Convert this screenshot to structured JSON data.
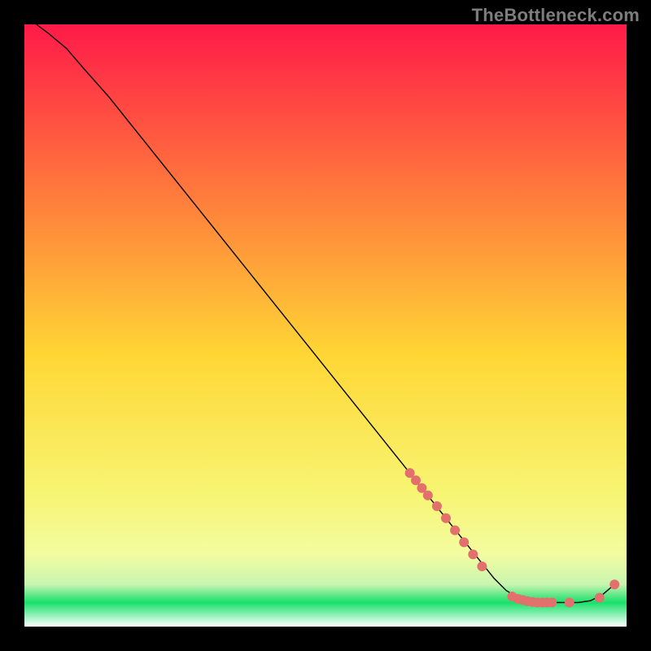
{
  "watermark": "TheBottleneck.com",
  "chart_data": {
    "type": "line",
    "title": "",
    "xlabel": "",
    "ylabel": "",
    "xlim": [
      0,
      100
    ],
    "ylim": [
      0,
      100
    ],
    "grid": false,
    "background_gradient": {
      "top_color": "#ff1a49",
      "mid_top_color": "#ff7a3c",
      "mid_color": "#ffd735",
      "mid_bot_color": "#f7f573",
      "green_band_color": "#18e06a",
      "bottom_color": "#ffffff",
      "green_band_start_y": 93,
      "green_band_end_y": 98
    },
    "series": [
      {
        "name": "curve",
        "color": "#000000",
        "stroke_width": 1.4,
        "x": [
          2,
          4,
          7,
          10,
          14,
          18,
          22,
          26,
          30,
          34,
          38,
          42,
          46,
          50,
          54,
          58,
          62,
          64,
          66,
          68,
          70,
          72,
          74,
          76,
          78,
          80,
          82,
          84,
          86,
          88,
          90,
          92,
          94,
          96,
          98
        ],
        "y": [
          100,
          98.5,
          96,
          92.5,
          88,
          83,
          78,
          73,
          68,
          63,
          58,
          53,
          48,
          43,
          38,
          33,
          28,
          25.5,
          23,
          20.5,
          18,
          15.5,
          13,
          10.5,
          8,
          6,
          4.8,
          4.2,
          4,
          4,
          4,
          4,
          4.3,
          5.3,
          7
        ]
      }
    ],
    "scatter": [
      {
        "name": "dots",
        "color": "#e2716d",
        "radius": 6,
        "points": [
          {
            "x": 64.0,
            "y": 25.5
          },
          {
            "x": 65.0,
            "y": 24.3
          },
          {
            "x": 66.0,
            "y": 23.0
          },
          {
            "x": 67.0,
            "y": 21.8
          },
          {
            "x": 68.5,
            "y": 20.0
          },
          {
            "x": 70.0,
            "y": 18.0
          },
          {
            "x": 71.5,
            "y": 16.0
          },
          {
            "x": 73.0,
            "y": 14.0
          },
          {
            "x": 74.5,
            "y": 12.0
          },
          {
            "x": 76.0,
            "y": 10.0
          },
          {
            "x": 81.0,
            "y": 5.0
          },
          {
            "x": 82.0,
            "y": 4.6
          },
          {
            "x": 82.8,
            "y": 4.4
          },
          {
            "x": 83.6,
            "y": 4.2
          },
          {
            "x": 84.4,
            "y": 4.1
          },
          {
            "x": 85.2,
            "y": 4.0
          },
          {
            "x": 86.0,
            "y": 4.0
          },
          {
            "x": 86.8,
            "y": 4.0
          },
          {
            "x": 87.6,
            "y": 4.0
          },
          {
            "x": 90.5,
            "y": 4.0
          },
          {
            "x": 95.5,
            "y": 4.8
          },
          {
            "x": 98.0,
            "y": 7.0
          }
        ]
      }
    ]
  }
}
